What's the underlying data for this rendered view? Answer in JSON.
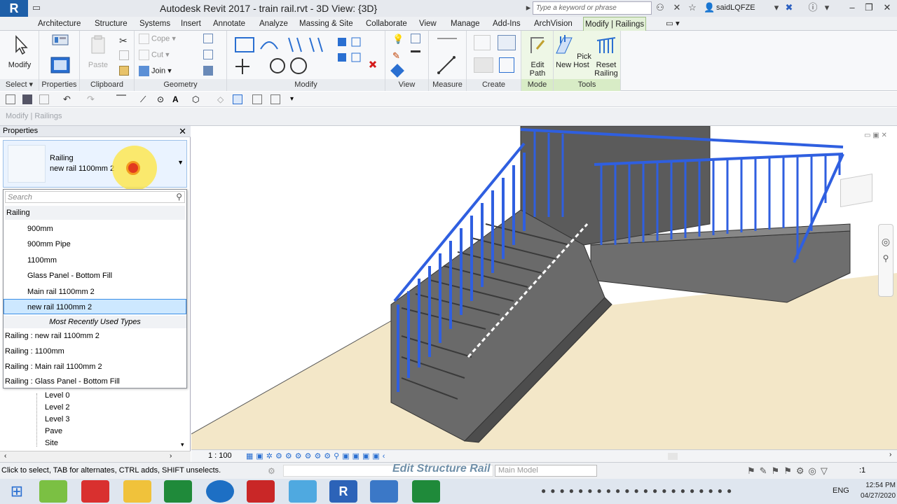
{
  "titlebar": {
    "app_title": "Autodesk Revit 2017 -    train rail.rvt - 3D View: {3D}",
    "search_placeholder": "Type a keyword or phrase",
    "user": "saidLQFZE"
  },
  "tabs": [
    "Architecture",
    "Structure",
    "Systems",
    "Insert",
    "Annotate",
    "Analyze",
    "Massing & Site",
    "Collaborate",
    "View",
    "Manage",
    "Add-Ins",
    "ArchVision",
    "Modify | Railings"
  ],
  "ribbon": {
    "modify_label": "Modify",
    "properties_label": "Properties",
    "paste_label": "Paste",
    "cope_label": "Cope",
    "cut_label": "Cut",
    "join_label": "Join",
    "edit_path_label": "Edit\nPath",
    "pick_new_host_label": "Pick\nNew Host",
    "reset_railing_label": "Reset\nRailing",
    "groups": {
      "select": "Select",
      "properties": "Properties",
      "clipboard": "Clipboard",
      "geometry": "Geometry",
      "modify": "Modify",
      "view": "View",
      "measure": "Measure",
      "create": "Create",
      "mode": "Mode",
      "tools": "Tools"
    }
  },
  "optionsbar": {
    "label": "Modify | Railings"
  },
  "properties": {
    "title": "Properties",
    "type_family": "Railing",
    "type_name": "new rail  1100mm 2",
    "search_placeholder": "Search",
    "family_header": "Railing",
    "types": [
      "900mm",
      "900mm Pipe",
      "1100mm",
      "Glass Panel - Bottom Fill",
      "Main  rail 1100mm 2",
      "new rail  1100mm 2"
    ],
    "mru_header": "Most Recently Used Types",
    "mru": [
      "Railing : new rail  1100mm 2",
      "Railing : 1100mm",
      "Railing : Main  rail 1100mm 2",
      "Railing : Glass Panel - Bottom Fill"
    ]
  },
  "browser": {
    "levels": [
      "Level 0",
      "Level 2",
      "Level 3",
      "Pave",
      "Site"
    ]
  },
  "viewctrl": {
    "scale": "1 : 100"
  },
  "status": {
    "hint": "Click to select, TAB for alternates, CTRL adds, SHIFT unselects.",
    "caption": "Edit Structure Rail",
    "model": "Main Model"
  },
  "tray": {
    "lang": "ENG",
    "time": "12:54 PM",
    "date": "04/27/2020"
  },
  "colors": {
    "ribbon_ctx": "#eef7e6",
    "railing_blue": "#2f5fe0",
    "ground": "#f3e7c8",
    "stair": "#6b6b6b"
  }
}
